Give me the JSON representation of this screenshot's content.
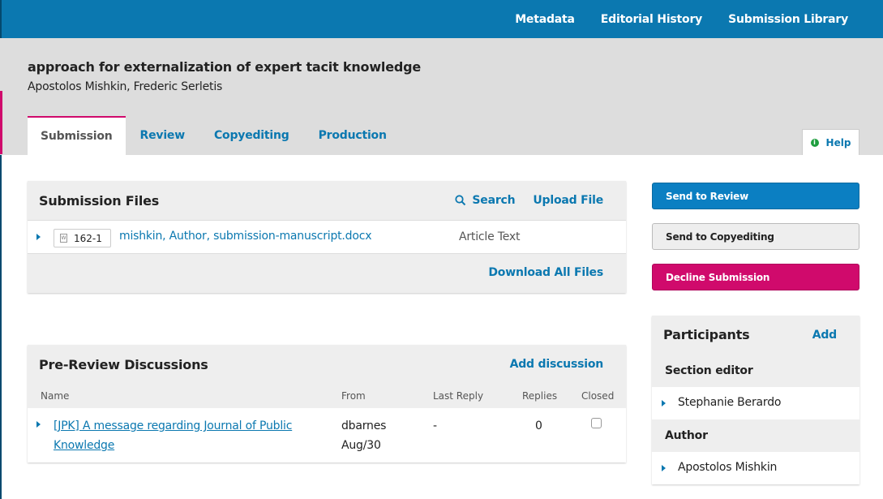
{
  "nav": {
    "metadata": "Metadata",
    "editorial_history": "Editorial History",
    "submission_library": "Submission Library"
  },
  "submission": {
    "title": "approach for externalization of expert tacit knowledge",
    "authors": "Apostolos Mishkin, Frederic Serletis"
  },
  "tabs": [
    {
      "label": "Submission",
      "active": true
    },
    {
      "label": "Review"
    },
    {
      "label": "Copyediting"
    },
    {
      "label": "Production"
    }
  ],
  "help": {
    "label": "Help",
    "icon": "info-icon"
  },
  "files_panel": {
    "title": "Submission Files",
    "search": "Search",
    "upload": "Upload File",
    "files": [
      {
        "id": "162-1",
        "name": "mishkin, Author, submission-manuscript.docx",
        "type": "Article Text",
        "icon": "word-doc-icon"
      }
    ],
    "download_all": "Download All Files"
  },
  "discussions": {
    "title": "Pre-Review Discussions",
    "add": "Add discussion",
    "columns": {
      "name": "Name",
      "from": "From",
      "last_reply": "Last Reply",
      "replies": "Replies",
      "closed": "Closed"
    },
    "rows": [
      {
        "subject": "[JPK] A message regarding Journal of Public Knowledge",
        "from": "dbarnes",
        "date": "Aug/30",
        "last_reply": "-",
        "replies": "0",
        "closed": false
      }
    ]
  },
  "actions": {
    "send_review": "Send to Review",
    "send_copyediting": "Send to Copyediting",
    "decline": "Decline Submission"
  },
  "participants": {
    "title": "Participants",
    "add": "Add",
    "groups": [
      {
        "role": "Section editor",
        "people": [
          "Stephanie Berardo"
        ]
      },
      {
        "role": "Author",
        "people": [
          "Apostolos Mishkin"
        ]
      }
    ]
  },
  "colors": {
    "brand_blue": "#0b78b0",
    "accent_pink": "#d00a6c",
    "header_gray": "#dddddd"
  }
}
